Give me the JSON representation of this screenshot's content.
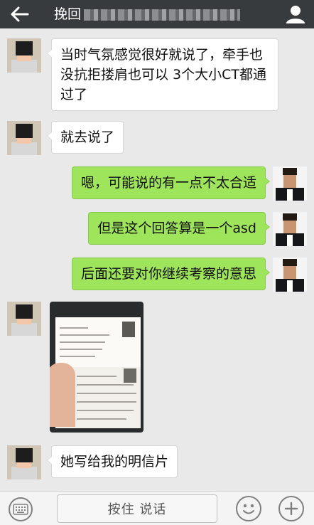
{
  "header": {
    "title": "挽回",
    "back_icon": "back-arrow-icon",
    "profile_icon": "person-icon"
  },
  "messages": [
    {
      "side": "in",
      "text": "当时气氛感觉很好就说了，牵手也没抗拒搂肩也可以 3个大小CT都通过了"
    },
    {
      "side": "in",
      "text": "就去说了"
    },
    {
      "side": "out",
      "text": "嗯，可能说的有一点不太合适"
    },
    {
      "side": "out",
      "text": "但是这个回答算是一个asd"
    },
    {
      "side": "out",
      "text": "后面还要对你继续考察的意思"
    },
    {
      "side": "in",
      "type": "image"
    },
    {
      "side": "in",
      "text": "她写给我的明信片"
    }
  ],
  "input_bar": {
    "hold_to_talk": "按住 说话",
    "keyboard_icon": "keyboard-icon",
    "emoji_icon": "emoji-icon",
    "plus_icon": "plus-icon"
  },
  "colors": {
    "topbar": "#383b3e",
    "background": "#e9e9e9",
    "outgoing_bubble": "#9fe55b",
    "incoming_bubble": "#ffffff"
  }
}
